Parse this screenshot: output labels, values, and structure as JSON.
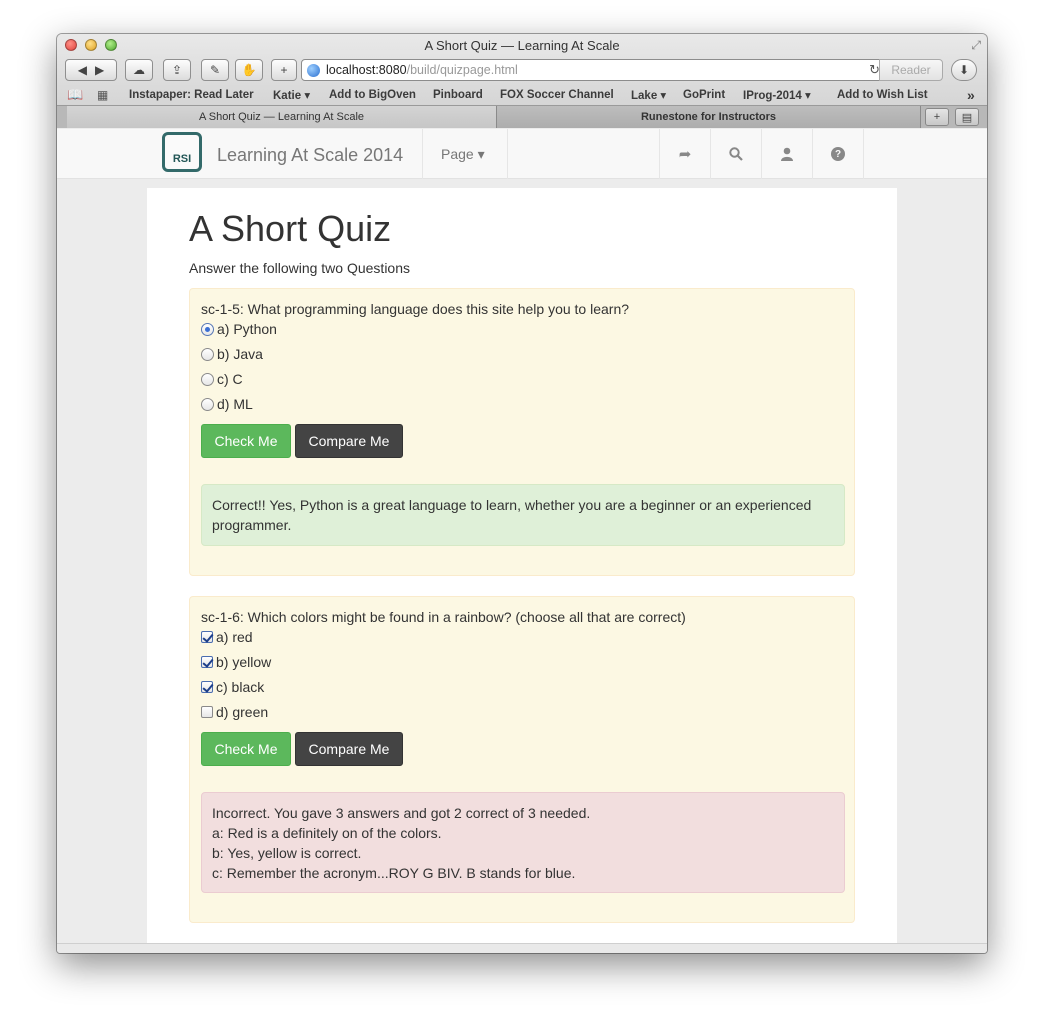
{
  "window": {
    "title": "A Short Quiz — Learning At Scale"
  },
  "toolbar": {
    "back": "◀",
    "forward": "▶",
    "url_host": "localhost:8080",
    "url_path": "/build/quizpage.html",
    "reload": "↻",
    "reader": "Reader",
    "add": "+"
  },
  "bookmarks": [
    "Instapaper: Read Later",
    "Katie ▾",
    "Add to BigOven",
    "Pinboard",
    "FOX Soccer Channel",
    "Lake ▾",
    "GoPrint",
    "IProg-2014 ▾",
    "Add to Wish List"
  ],
  "bookmarks_more": "»",
  "tabs": [
    "A Short Quiz — Learning At Scale",
    "Runestone for Instructors"
  ],
  "tab_new": "+",
  "navbar": {
    "logo_text": "RSI",
    "brand": "Learning At Scale 2014",
    "page_menu": "Page ▾"
  },
  "page": {
    "title": "A Short Quiz",
    "intro": "Answer the following two Questions"
  },
  "questions": [
    {
      "text": "sc-1-5: What programming language does this site help you to learn?",
      "options": [
        "a) Python",
        "b) Java",
        "c) C",
        "d) ML"
      ],
      "check_label": "Check Me",
      "compare_label": "Compare Me",
      "feedback": [
        "Correct!! Yes, Python is a great language to learn, whether you are a beginner or an experienced",
        "programmer."
      ]
    },
    {
      "text": "sc-1-6: Which colors might be found in a rainbow? (choose all that are correct)",
      "options": [
        "a) red",
        "b) yellow",
        "c) black",
        "d) green"
      ],
      "check_label": "Check Me",
      "compare_label": "Compare Me",
      "feedback": [
        "Incorrect. You gave 3 answers and got 2 correct of 3 needed.",
        "a: Red is a definitely on of the colors.",
        "b: Yes, yellow is correct.",
        "c: Remember the acronym...ROY G BIV. B stands for blue."
      ]
    }
  ],
  "colors": {
    "success": "#5cb85c",
    "dark_button": "#444444",
    "panel": "#fcf8e3",
    "correct_bg": "#dff0d8",
    "incorrect_bg": "#f2dede"
  }
}
